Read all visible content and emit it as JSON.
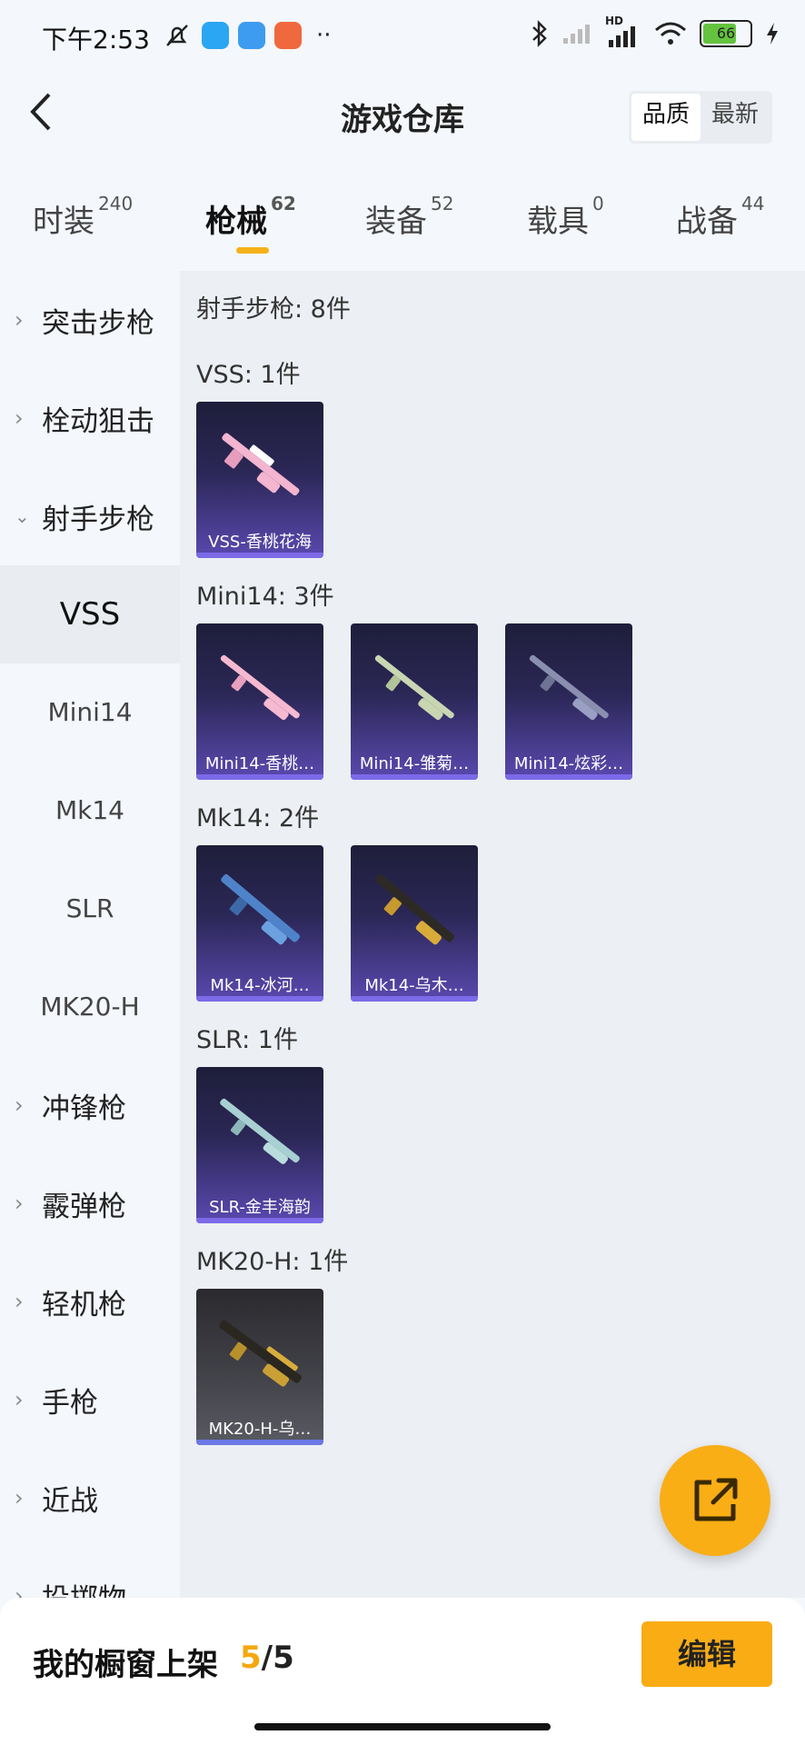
{
  "status_bar": {
    "time": "下午2:53",
    "battery": "66",
    "network": "HD"
  },
  "header": {
    "title": "游戏仓库",
    "sort_options": [
      "品质",
      "最新"
    ]
  },
  "tabs": [
    {
      "label": "时装",
      "count": "240"
    },
    {
      "label": "枪械",
      "count": "62"
    },
    {
      "label": "装备",
      "count": "52"
    },
    {
      "label": "载具",
      "count": "0"
    },
    {
      "label": "战备",
      "count": "44"
    }
  ],
  "sidebar": {
    "items": [
      "突击步枪",
      "栓动狙击",
      "射手步枪"
    ],
    "subitems": [
      "VSS",
      "Mini14",
      "Mk14",
      "SLR",
      "MK20-H"
    ],
    "items_after": [
      "冲锋枪",
      "霰弹枪",
      "轻机枪",
      "手枪",
      "近战",
      "投掷物"
    ]
  },
  "content": {
    "category_title": "射手步枪: 8件",
    "groups": [
      {
        "title": "VSS: 1件",
        "items": [
          "VSS-香桃花海"
        ]
      },
      {
        "title": "Mini14: 3件",
        "items": [
          "Mini14-香桃…",
          "Mini14-雏菊…",
          "Mini14-炫彩…"
        ]
      },
      {
        "title": "Mk14: 2件",
        "items": [
          "Mk14-冰河…",
          "Mk14-乌木…"
        ]
      },
      {
        "title": "SLR: 1件",
        "items": [
          "SLR-金丰海韵"
        ]
      },
      {
        "title": "MK20-H: 1件",
        "items": [
          "MK20-H-乌…"
        ]
      }
    ]
  },
  "bottom_bar": {
    "label": "我的橱窗上架",
    "count_current": "5",
    "count_sep": "/",
    "count_total": "5",
    "edit_label": "编辑"
  },
  "colors": {
    "accent": "#f9ac14",
    "card_bg": "#2b2756",
    "card_bar": "#7c6ae8"
  },
  "icons": {
    "back": "chevron-left-icon",
    "fab": "share-external-icon"
  }
}
